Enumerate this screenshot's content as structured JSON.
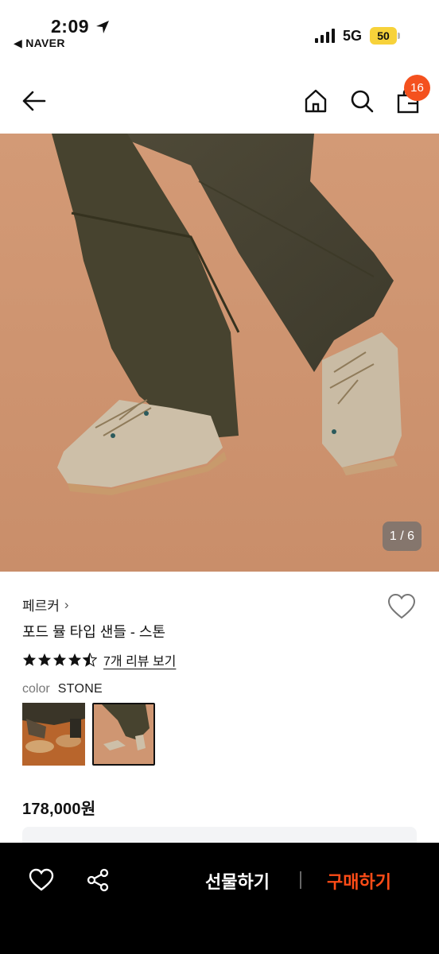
{
  "status_bar": {
    "time": "2:09",
    "back_app": "◀ NAVER",
    "network": "5G",
    "battery": "50"
  },
  "header": {
    "cart_count": "16"
  },
  "gallery": {
    "counter": "1 / 6"
  },
  "product": {
    "brand": "페르커",
    "brand_chevron": "›",
    "title": "포드 뮬 타입 샌들 - 스톤",
    "rating_stars": 4.5,
    "review_link": "7개 리뷰 보기",
    "color_label": "color",
    "color_value": "STONE",
    "price": "178,000원"
  },
  "bottom_bar": {
    "gift_label": "선물하기",
    "buy_label": "구매하기"
  },
  "colors": {
    "accent": "#ff4c17",
    "badge": "#f4511e",
    "hero_bg": "#cf9672"
  },
  "icons": [
    "back-arrow-icon",
    "home-icon",
    "search-icon",
    "bag-icon",
    "heart-icon",
    "share-icon",
    "star-icon",
    "location-arrow-icon",
    "signal-icon"
  ]
}
